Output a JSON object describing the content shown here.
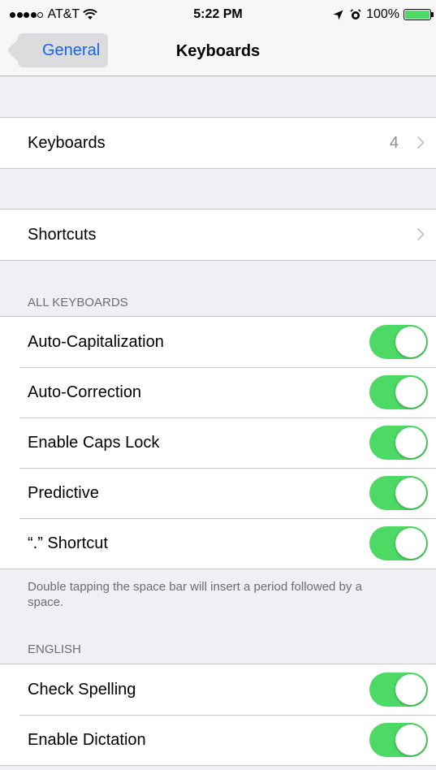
{
  "status_bar": {
    "carrier": "AT&T",
    "time": "5:22 PM",
    "battery": "100%",
    "signal_bars_filled": 4,
    "signal_bars_total": 5
  },
  "nav": {
    "back_label": "General",
    "title": "Keyboards"
  },
  "keyboards_row": {
    "label": "Keyboards",
    "count": "4"
  },
  "shortcuts_row": {
    "label": "Shortcuts"
  },
  "all_keyboards": {
    "header": "ALL KEYBOARDS",
    "items": [
      {
        "label": "Auto-Capitalization",
        "on": true
      },
      {
        "label": "Auto-Correction",
        "on": true
      },
      {
        "label": "Enable Caps Lock",
        "on": true
      },
      {
        "label": "Predictive",
        "on": true
      },
      {
        "label": "“.” Shortcut",
        "on": true
      }
    ],
    "footer": "Double tapping the space bar will insert a period followed by a space."
  },
  "english": {
    "header": "ENGLISH",
    "items": [
      {
        "label": "Check Spelling",
        "on": true
      },
      {
        "label": "Enable Dictation",
        "on": true
      }
    ]
  },
  "colors": {
    "accent": "#1565e8",
    "toggle_on": "#4cd964",
    "background": "#efeff4"
  }
}
